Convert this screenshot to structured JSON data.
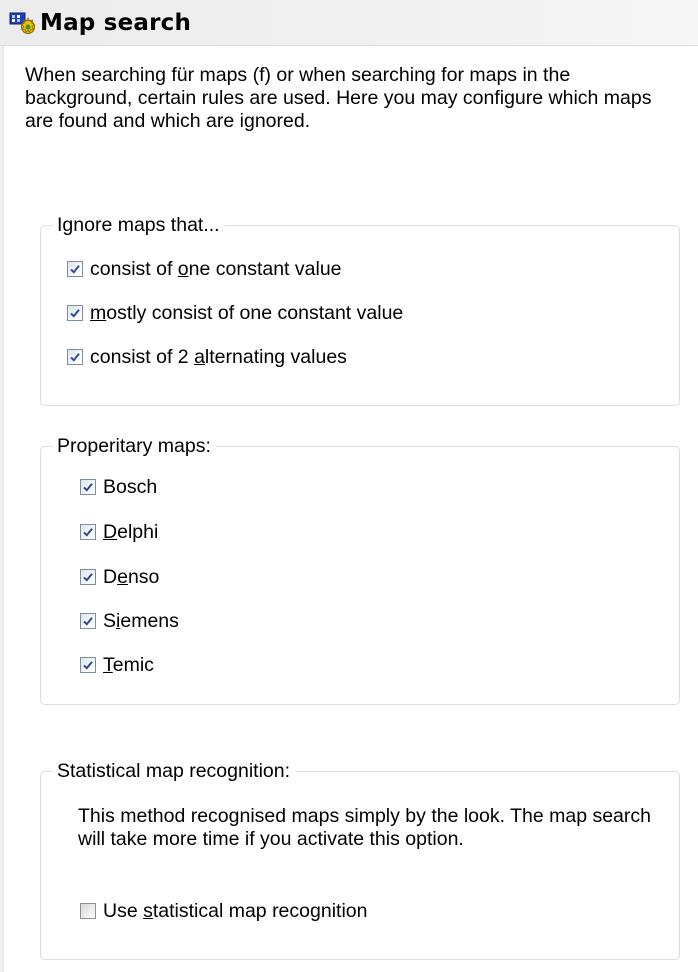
{
  "header": {
    "title": "Map search",
    "icon": "map-search-icon"
  },
  "intro_text": "When searching für maps (f) or when searching for maps in the background, certain rules are used. Here you may configure which maps are found and which are ignored.",
  "ignore_group": {
    "legend": "Ignore maps that...",
    "options": [
      {
        "before": "consist of ",
        "mnemonic": "o",
        "after": "ne constant value",
        "checked": true
      },
      {
        "before": "",
        "mnemonic": "m",
        "after": "ostly consist of one constant value",
        "checked": true
      },
      {
        "before": "consist of 2 ",
        "mnemonic": "a",
        "after": "lternating values",
        "checked": true
      }
    ]
  },
  "proprietary_group": {
    "legend": "Properitary maps:",
    "options": [
      {
        "before": "Bosch",
        "mnemonic": "",
        "after": "",
        "checked": true
      },
      {
        "before": "",
        "mnemonic": "D",
        "after": "elphi",
        "checked": true
      },
      {
        "before": "D",
        "mnemonic": "e",
        "after": "nso",
        "checked": true
      },
      {
        "before": "S",
        "mnemonic": "i",
        "after": "emens",
        "checked": true
      },
      {
        "before": "",
        "mnemonic": "T",
        "after": "emic",
        "checked": true
      }
    ]
  },
  "statistical_group": {
    "legend": "Statistical map recognition:",
    "description": "This method recognised maps simply by the look. The map search will take more time if you activate this option.",
    "option": {
      "before": "Use ",
      "mnemonic": "s",
      "after": "tatistical map recognition",
      "checked": false
    }
  },
  "colors": {
    "checkmark": "#2a4a9a",
    "group_border": "#d5dfe5",
    "titlebar": "#ececec"
  }
}
